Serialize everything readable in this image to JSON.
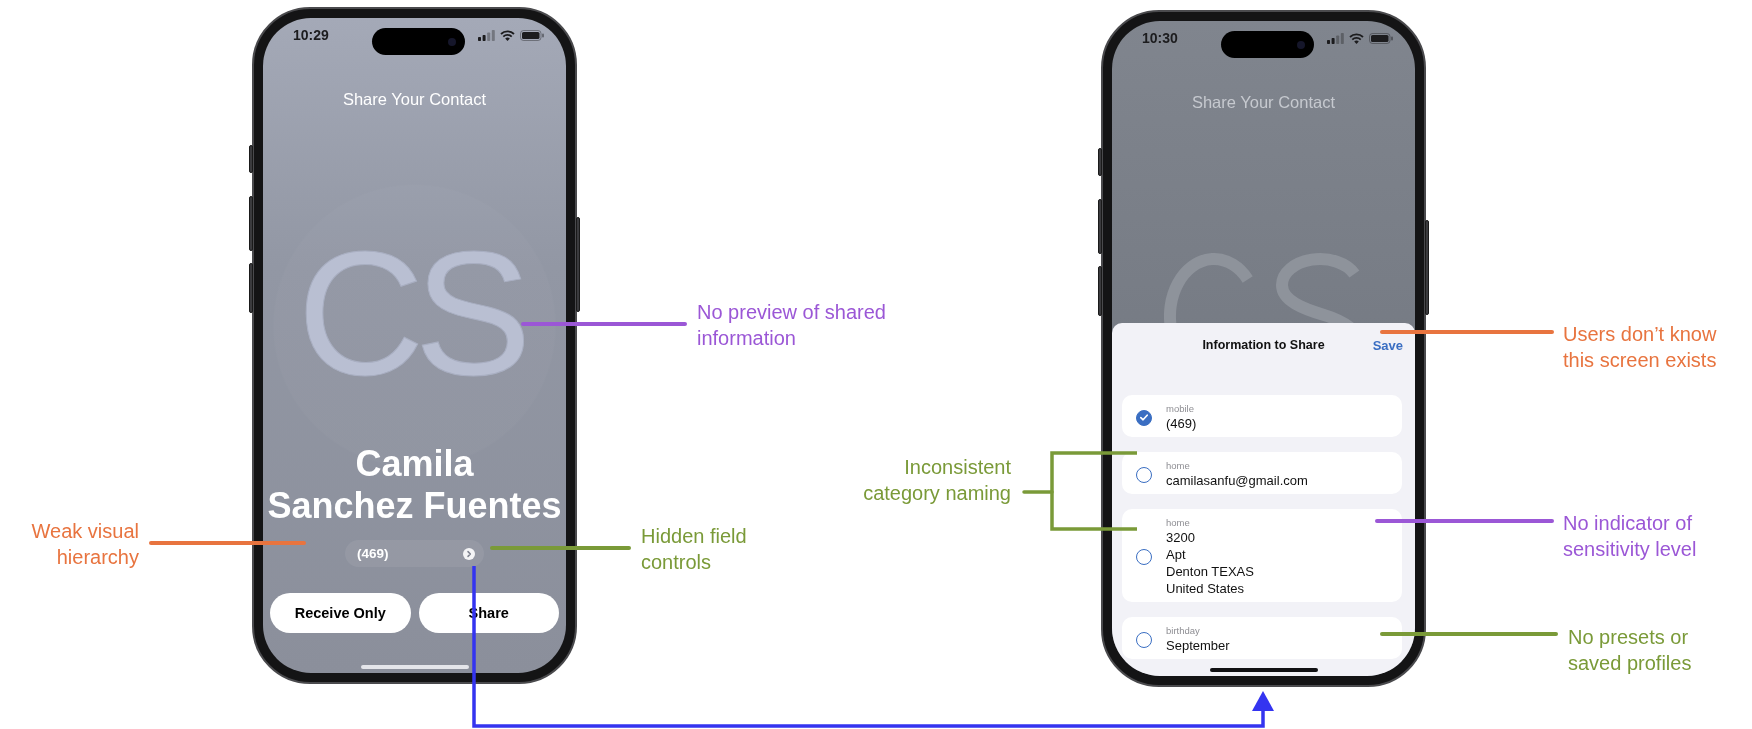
{
  "phones": [
    {
      "kind": "contact_card",
      "status_bar": {
        "time": "10:29"
      },
      "title": "Share Your Contact",
      "monogram": "CS",
      "name_lines": [
        "Camila",
        "Sanchez Fuentes"
      ],
      "phone_selector": "(469)",
      "buttons": [
        "Receive Only",
        "Share"
      ]
    },
    {
      "kind": "share_sheet",
      "status_bar": {
        "time": "10:30"
      },
      "title": "Share Your Contact",
      "sheet": {
        "title": "Information to Share",
        "action": "Save",
        "fields": [
          {
            "label": "mobile",
            "value_lines": [
              "(469)"
            ],
            "checked": true
          },
          {
            "label": "home",
            "value_lines": [
              "camilasanfu@gmail.com"
            ],
            "checked": false
          },
          {
            "label": "home",
            "value_lines": [
              "3200",
              "Apt",
              "Denton TEXAS",
              "United States"
            ],
            "checked": false
          },
          {
            "label": "birthday",
            "value_lines": [
              "September"
            ],
            "checked": false
          }
        ]
      }
    }
  ],
  "annotations": [
    {
      "kind": "leader",
      "text_lines": [
        "No preview of shared",
        "information"
      ],
      "color": "#9b57d6"
    },
    {
      "kind": "leader",
      "text_lines": [
        "Weak visual",
        "hierarchy"
      ],
      "color": "#e8743f"
    },
    {
      "kind": "leader",
      "text_lines": [
        "Hidden field",
        "controls"
      ],
      "color": "#7a9a38"
    },
    {
      "kind": "bracket",
      "text_lines": [
        "Inconsistent",
        "category naming"
      ],
      "color": "#7a9a38"
    },
    {
      "kind": "leader",
      "text_lines": [
        "Users don’t know",
        "this screen exists"
      ],
      "color": "#e8743f"
    },
    {
      "kind": "leader",
      "text_lines": [
        "No indicator of",
        "sensitivity level"
      ],
      "color": "#9b57d6"
    },
    {
      "kind": "leader",
      "text_lines": [
        "No presets or",
        "saved profiles"
      ],
      "color": "#7a9a38"
    }
  ]
}
